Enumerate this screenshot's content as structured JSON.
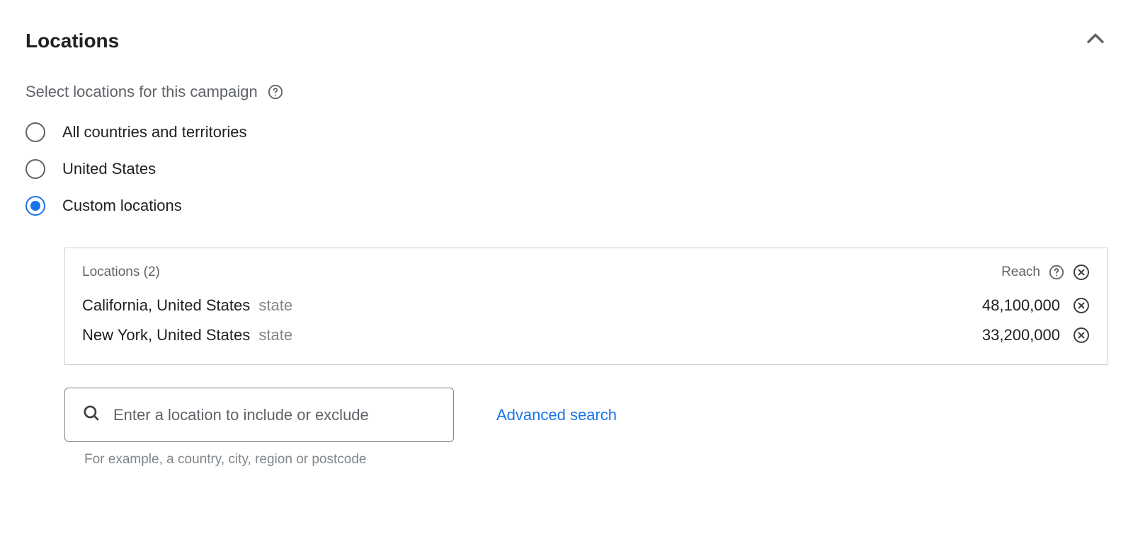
{
  "section": {
    "title": "Locations",
    "subtitle": "Select locations for this campaign"
  },
  "radio": {
    "option1": "All countries and territories",
    "option2": "United States",
    "option3": "Custom locations"
  },
  "locationsBox": {
    "header": "Locations (2)",
    "reachLabel": "Reach",
    "items": [
      {
        "name": "California, United States",
        "type": "state",
        "reach": "48,100,000"
      },
      {
        "name": "New York, United States",
        "type": "state",
        "reach": "33,200,000"
      }
    ]
  },
  "search": {
    "placeholder": "Enter a location to include or exclude",
    "advancedLabel": "Advanced search",
    "hint": "For example, a country, city, region or postcode"
  }
}
